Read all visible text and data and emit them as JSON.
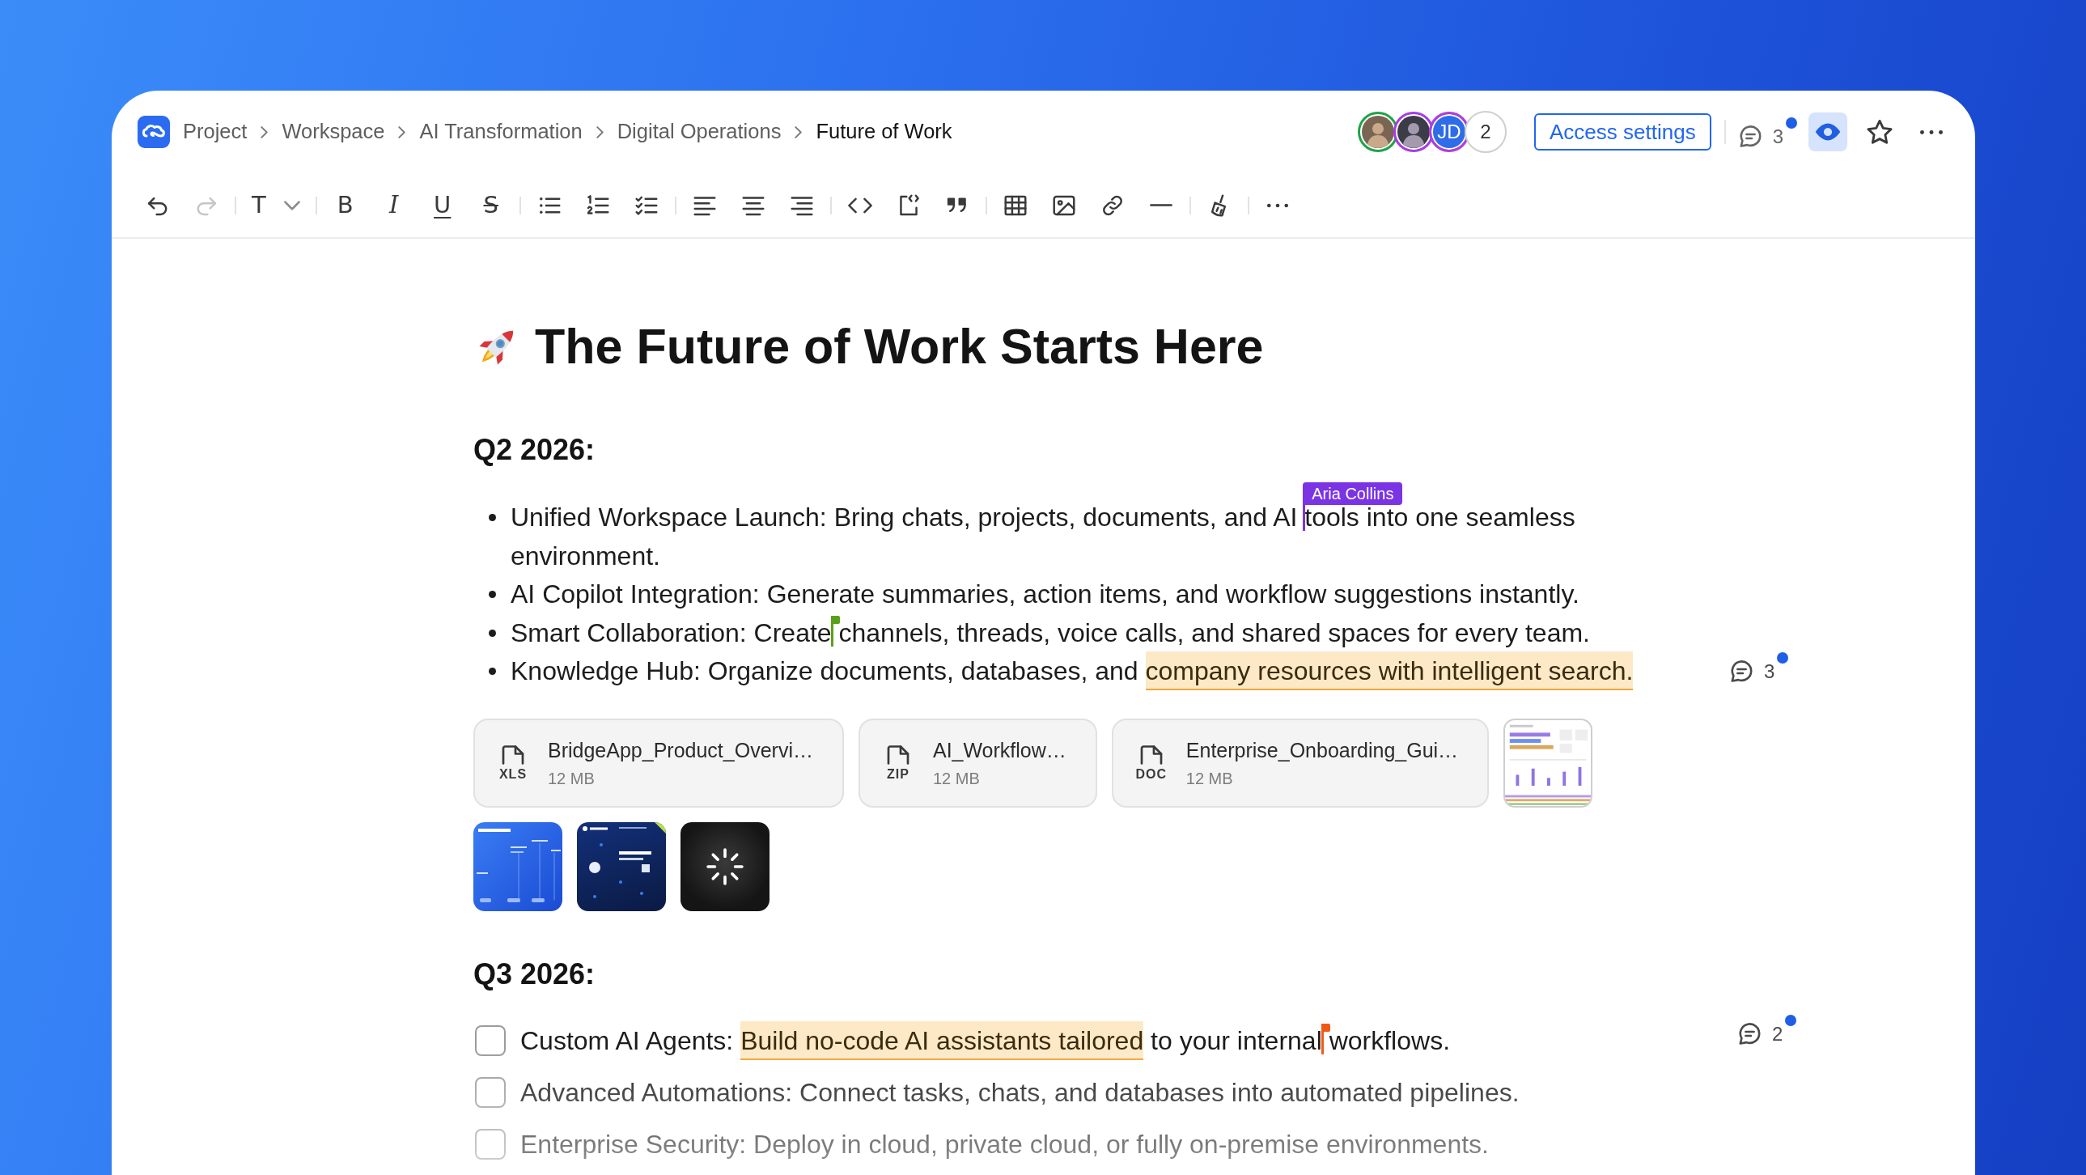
{
  "header": {
    "breadcrumbs": [
      {
        "label": "Project",
        "current": false
      },
      {
        "label": "Workspace",
        "current": false
      },
      {
        "label": "AI Transformation",
        "current": false
      },
      {
        "label": "Digital Operations",
        "current": false
      },
      {
        "label": "Future of Work",
        "current": true
      }
    ],
    "collaborators": [
      {
        "kind": "photo",
        "color": "#1fa347"
      },
      {
        "kind": "photo",
        "color": "#a53de3"
      },
      {
        "kind": "initials",
        "initials": "JD",
        "color": "#b23ddd"
      }
    ],
    "more_collaborators": "2",
    "access_button": "Access settings",
    "comments": {
      "count": "3",
      "unread": true
    },
    "actions": [
      {
        "kind": "preview",
        "selected": true
      },
      {
        "kind": "favorite",
        "selected": false
      },
      {
        "kind": "more",
        "selected": false
      }
    ]
  },
  "toolbar": [
    [
      {
        "kind": "undo",
        "disabled": false
      },
      {
        "kind": "redo",
        "disabled": true
      }
    ],
    [
      {
        "kind": "heading",
        "glyph": "T",
        "disabled": false
      }
    ],
    [
      {
        "kind": "bold",
        "glyph": "B",
        "disabled": false
      },
      {
        "kind": "italic",
        "glyph": "I",
        "disabled": false
      },
      {
        "kind": "underline",
        "glyph": "U",
        "disabled": false
      },
      {
        "kind": "strikethrough",
        "glyph": "S",
        "disabled": false
      }
    ],
    [
      {
        "kind": "bullets",
        "disabled": false
      },
      {
        "kind": "numbered",
        "disabled": false
      },
      {
        "kind": "checklist",
        "disabled": false
      }
    ],
    [
      {
        "kind": "alignleft",
        "disabled": false
      },
      {
        "kind": "aligncenter",
        "disabled": false
      },
      {
        "kind": "alignright",
        "disabled": false
      }
    ],
    [
      {
        "kind": "code",
        "disabled": false
      },
      {
        "kind": "codeblock",
        "disabled": false
      },
      {
        "kind": "quote",
        "disabled": false
      }
    ],
    [
      {
        "kind": "table",
        "disabled": false
      },
      {
        "kind": "image",
        "disabled": false
      },
      {
        "kind": "link",
        "disabled": false
      },
      {
        "kind": "divider",
        "disabled": false
      }
    ],
    [
      {
        "kind": "clean",
        "disabled": false
      }
    ],
    [
      {
        "kind": "more",
        "disabled": false
      }
    ]
  ],
  "document": {
    "title": "The Future of Work Starts Here",
    "sections": [
      {
        "heading": "Q2 2026:",
        "kind": "bullets",
        "items": [
          {
            "runs": [
              {
                "text": "Unified Workspace Launch: Bring chats, projects, documents, and AI ",
                "highlighted": false
              },
              {
                "text": "tools into one seamless environment.",
                "highlighted": false,
                "cursor": {
                  "user": "Aria Collins",
                  "color": "#7b34e4",
                  "expanded": true
                }
              }
            ]
          },
          {
            "runs": [
              {
                "text": "AI Copilot Integration: Generate summaries, action items, and workflow suggestions instantly.",
                "highlighted": false
              }
            ]
          },
          {
            "runs": [
              {
                "text": "Smart Collaboration: Create ",
                "highlighted": false
              },
              {
                "text": "channels, threads, voice calls, and shared spaces for every team.",
                "highlighted": false,
                "cursor": {
                  "color": "#5aa119",
                  "expanded": false
                }
              }
            ]
          },
          {
            "runs": [
              {
                "text": "Knowledge Hub: Organize documents, databases, and ",
                "highlighted": false
              },
              {
                "text": "company resources with intelligent search.",
                "highlighted": true
              }
            ],
            "comments": {
              "count": "3",
              "unread": true
            }
          }
        ],
        "attachments": {
          "files": [
            {
              "name": "BridgeApp_Product_Overvi…",
              "type": "XLS",
              "size": "12 MB"
            },
            {
              "name": "AI_Workflow…",
              "type": "ZIP",
              "size": "12 MB"
            },
            {
              "name": "Enterprise_Onboarding_Gui…",
              "type": "DOC",
              "size": "12 MB"
            }
          ],
          "images": [
            {
              "kind": "dashboard",
              "loading": false
            },
            {
              "kind": "slides",
              "loading": false
            },
            {
              "kind": "banner",
              "loading": false
            },
            {
              "kind": "photo",
              "loading": true
            }
          ]
        }
      },
      {
        "heading": "Q3 2026:",
        "kind": "checklist",
        "items": [
          {
            "checked": false,
            "runs": [
              {
                "text": "Custom AI Agents: ",
                "highlighted": false
              },
              {
                "text": "Build no-code AI assistants tailored",
                "highlighted": true
              },
              {
                "text": " to your internal ",
                "highlighted": false
              },
              {
                "text": "workflows.",
                "highlighted": false,
                "cursor": {
                  "color": "#f05a14",
                  "expanded": false
                }
              }
            ],
            "comments": {
              "count": "2",
              "unread": true
            }
          },
          {
            "checked": false,
            "runs": [
              {
                "text": "Advanced Automations: Connect tasks, chats, and databases into automated pipelines.",
                "highlighted": false
              }
            ]
          },
          {
            "checked": false,
            "runs": [
              {
                "text": "Enterprise Security: Deploy in cloud, private cloud, or fully on-premise environments.",
                "highlighted": false
              }
            ]
          }
        ]
      }
    ]
  }
}
